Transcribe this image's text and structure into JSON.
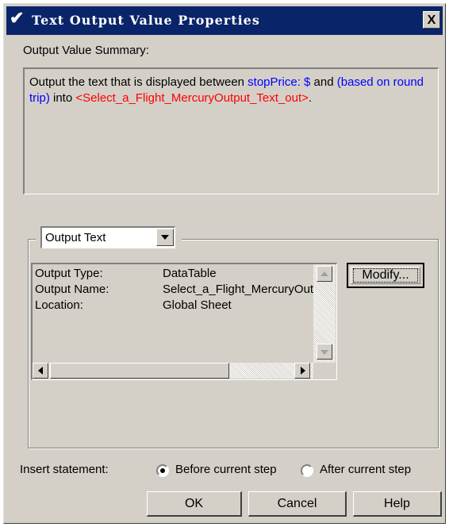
{
  "window": {
    "title": "Text Output Value Properties",
    "close_label": "X"
  },
  "summary": {
    "label": "Output Value Summary:",
    "text_part1": "Output the text that is displayed between ",
    "start_marker": "stopPrice: $",
    "text_part2": " and ",
    "end_marker": "(based on round trip)",
    "text_part3": " into ",
    "target": "<Select_a_Flight_MercuryOutput_Text_out>",
    "text_part4": "."
  },
  "output_type_select": {
    "selected": "Output Text"
  },
  "details": {
    "rows": [
      {
        "key": "Output Type:",
        "value": "DataTable"
      },
      {
        "key": "Output Name:",
        "value": "Select_a_Flight_MercuryOutput_Text_out"
      },
      {
        "key": "Location:",
        "value": "Global Sheet"
      }
    ],
    "modify_label": "Modify..."
  },
  "insert": {
    "label": "Insert statement:",
    "option_before": "Before current step",
    "option_after": "After current step",
    "selected": "before"
  },
  "buttons": {
    "ok": "OK",
    "cancel": "Cancel",
    "help": "Help"
  },
  "colors": {
    "titlebar": "#0a246a",
    "face": "#d4d0c8",
    "marker_blue": "#0000ff",
    "target_red": "#ff0000"
  }
}
